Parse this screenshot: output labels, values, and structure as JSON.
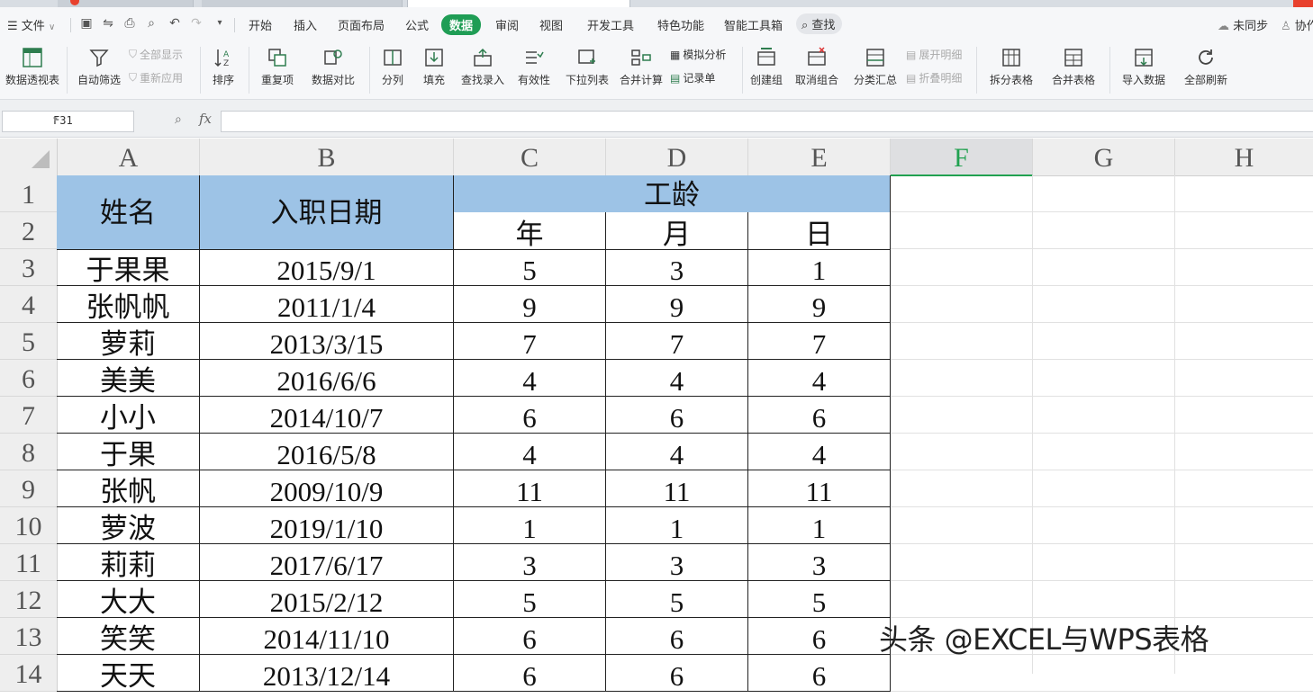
{
  "menu": {
    "file": "文件",
    "tabs": [
      "开始",
      "插入",
      "页面布局",
      "公式",
      "数据",
      "审阅",
      "视图",
      "开发工具",
      "特色功能",
      "智能工具箱"
    ],
    "active_tab": "数据",
    "search": "查找",
    "sync": "未同步",
    "collab": "协作"
  },
  "ribbon": {
    "pivot": "数据透视表",
    "autofilter": "自动筛选",
    "show_all": "全部显示",
    "reapply": "重新应用",
    "sort": "排序",
    "duplicates": "重复项",
    "compare": "数据对比",
    "split": "分列",
    "fill": "填充",
    "lookup": "查找录入",
    "validity": "有效性",
    "dropdown": "下拉列表",
    "consolidate": "合并计算",
    "simulate": "模拟分析",
    "record": "记录单",
    "group": "创建组",
    "ungroup": "取消组合",
    "subtotal": "分类汇总",
    "expand": "展开明细",
    "collapse": "折叠明细",
    "split_table": "拆分表格",
    "merge_table": "合并表格",
    "import": "导入数据",
    "refresh": "全部刷新"
  },
  "formula_bar": {
    "cell_ref": "F31",
    "fx": "fx",
    "value": ""
  },
  "sheet": {
    "columns": [
      "A",
      "B",
      "C",
      "D",
      "E",
      "F",
      "G",
      "H"
    ],
    "selected_column": "F",
    "rows": [
      "1",
      "2",
      "3",
      "4",
      "5",
      "6",
      "7",
      "8",
      "9",
      "10",
      "11",
      "12",
      "13",
      "14"
    ],
    "headers": {
      "name": "姓名",
      "hire_date": "入职日期",
      "seniority": "工龄",
      "year": "年",
      "month": "月",
      "day": "日"
    },
    "data": [
      [
        "于果果",
        "2015/9/1",
        "5",
        "3",
        "1"
      ],
      [
        "张帆帆",
        "2011/1/4",
        "9",
        "9",
        "9"
      ],
      [
        "萝莉",
        "2013/3/15",
        "7",
        "7",
        "7"
      ],
      [
        "美美",
        "2016/6/6",
        "4",
        "4",
        "4"
      ],
      [
        "小小",
        "2014/10/7",
        "6",
        "6",
        "6"
      ],
      [
        "于果",
        "2016/5/8",
        "4",
        "4",
        "4"
      ],
      [
        "张帆",
        "2009/10/9",
        "11",
        "11",
        "11"
      ],
      [
        "萝波",
        "2019/1/10",
        "1",
        "1",
        "1"
      ],
      [
        "莉莉",
        "2017/6/17",
        "3",
        "3",
        "3"
      ],
      [
        "大大",
        "2015/2/12",
        "5",
        "5",
        "5"
      ],
      [
        "笑笑",
        "2014/11/10",
        "6",
        "6",
        "6"
      ],
      [
        "天天",
        "2013/12/14",
        "6",
        "6",
        "6"
      ]
    ]
  },
  "watermark": "头条 @EXCEL与WPS表格"
}
